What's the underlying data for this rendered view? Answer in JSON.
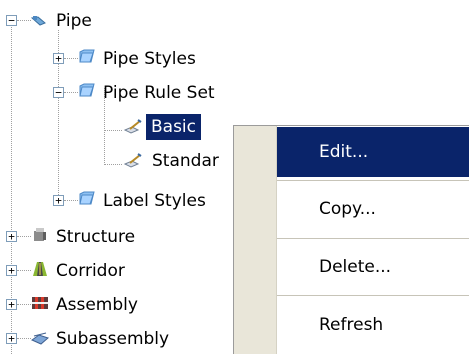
{
  "tree": {
    "pipe": "Pipe",
    "pipe_styles": "Pipe Styles",
    "pipe_rule_set": "Pipe Rule Set",
    "basic": "Basic",
    "standard_partial": "Standar",
    "label_styles": "Label Styles",
    "structure": "Structure",
    "corridor": "Corridor",
    "assembly": "Assembly",
    "subassembly_partial": "Subassembly"
  },
  "context_menu": {
    "edit": "Edit...",
    "copy": "Copy...",
    "delete": "Delete...",
    "refresh": "Refresh"
  },
  "colors": {
    "selection": "#0a246a",
    "menu_gutter": "#e9e6d9"
  },
  "icons": {
    "pipe": "pipe-icon",
    "folder": "folder-icon",
    "rule": "rule-icon",
    "structure": "structure-icon",
    "corridor": "corridor-icon",
    "assembly": "assembly-icon",
    "subassembly": "subassembly-icon"
  }
}
